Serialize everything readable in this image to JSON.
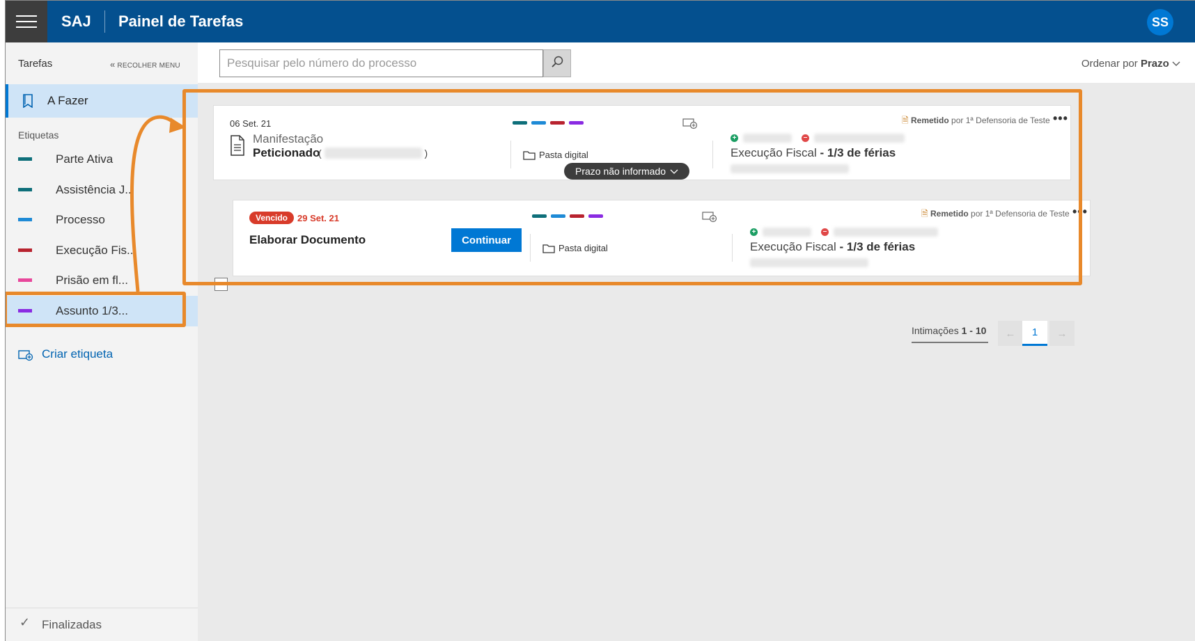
{
  "header": {
    "brand": "SAJ",
    "title": "Painel de Tarefas",
    "avatar_initials": "SS"
  },
  "sidebar": {
    "heading": "Tarefas",
    "collapse_label": "RECOLHER MENU",
    "active_item": "A Fazer",
    "tags_heading": "Etiquetas",
    "tags": [
      {
        "label": "Parte Ativa",
        "color": "#0e6f7a"
      },
      {
        "label": "Assistência J...",
        "color": "#0e6f7a"
      },
      {
        "label": "Processo",
        "color": "#1e8ad6"
      },
      {
        "label": "Execução Fis...",
        "color": "#b8232f"
      },
      {
        "label": "Prisão em fl...",
        "color": "#e8479b"
      },
      {
        "label": "Assunto 1/3...",
        "color": "#8a2be2"
      }
    ],
    "create_tag": "Criar etiqueta",
    "finished": "Finalizadas"
  },
  "search": {
    "placeholder": "Pesquisar pelo número do processo"
  },
  "sort": {
    "prefix": "Ordenar por",
    "value": "Prazo"
  },
  "cards": [
    {
      "date": "06 Set. 21",
      "type": "Manifestação",
      "title": "Peticionado",
      "pasta": "Pasta digital",
      "remetido_label": "Remetido",
      "remetido_by": "por 1ª Defensoria de Teste",
      "exec_prefix": "Execução Fiscal",
      "exec_suffix": "- 1/3 de férias",
      "deadline_pill": "Prazo não informado",
      "tag_colors": [
        "#0e6f7a",
        "#1e8ad6",
        "#b8232f",
        "#8a2be2"
      ]
    },
    {
      "status": "Vencido",
      "date": "29 Set. 21",
      "title": "Elaborar Documento",
      "action": "Continuar",
      "pasta": "Pasta digital",
      "remetido_label": "Remetido",
      "remetido_by": "por 1ª Defensoria de Teste",
      "exec_prefix": "Execução Fiscal",
      "exec_suffix": "- 1/3 de férias",
      "tag_colors": [
        "#0e6f7a",
        "#1e8ad6",
        "#b8232f",
        "#8a2be2"
      ]
    }
  ],
  "pagination": {
    "label": "Intimações",
    "range": "1 - 10",
    "current_page": "1"
  },
  "colors": {
    "header_bg": "#04508f",
    "accent": "#0078d4",
    "annotation": "#e8892b",
    "overdue": "#d83b2a"
  }
}
